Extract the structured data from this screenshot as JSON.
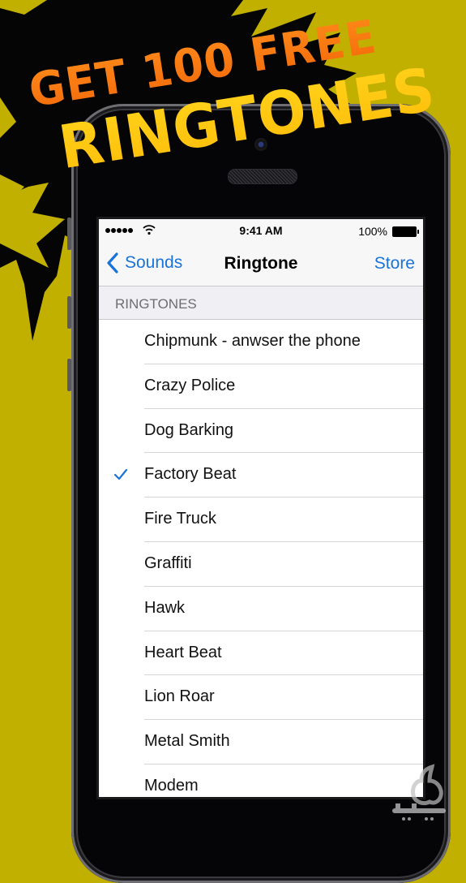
{
  "promo": {
    "line1": "GET 100 FREE",
    "line2": "RINGTONES"
  },
  "colors": {
    "background": "#c2b000",
    "accent": "#1a73d9",
    "promo_orange": "#f26a0a",
    "promo_yellow": "#ffc80a"
  },
  "statusbar": {
    "time": "9:41 AM",
    "battery": "100%",
    "signal_icon": "signal-dots-icon",
    "wifi_icon": "wifi-icon",
    "battery_icon": "battery-full-icon"
  },
  "navbar": {
    "back_label": "Sounds",
    "title": "Ringtone",
    "right_label": "Store",
    "back_icon": "chevron-left-icon"
  },
  "section": {
    "header": "RINGTONES"
  },
  "ringtones": [
    {
      "label": "Chipmunk - anwser the phone",
      "selected": false
    },
    {
      "label": "Crazy Police",
      "selected": false
    },
    {
      "label": "Dog Barking",
      "selected": false
    },
    {
      "label": "Factory Beat",
      "selected": true
    },
    {
      "label": "Fire Truck",
      "selected": false
    },
    {
      "label": "Graffiti",
      "selected": false
    },
    {
      "label": "Hawk",
      "selected": false
    },
    {
      "label": "Heart Beat",
      "selected": false
    },
    {
      "label": "Lion Roar",
      "selected": false
    },
    {
      "label": "Metal Smith",
      "selected": false
    },
    {
      "label": "Modem",
      "selected": false
    }
  ]
}
